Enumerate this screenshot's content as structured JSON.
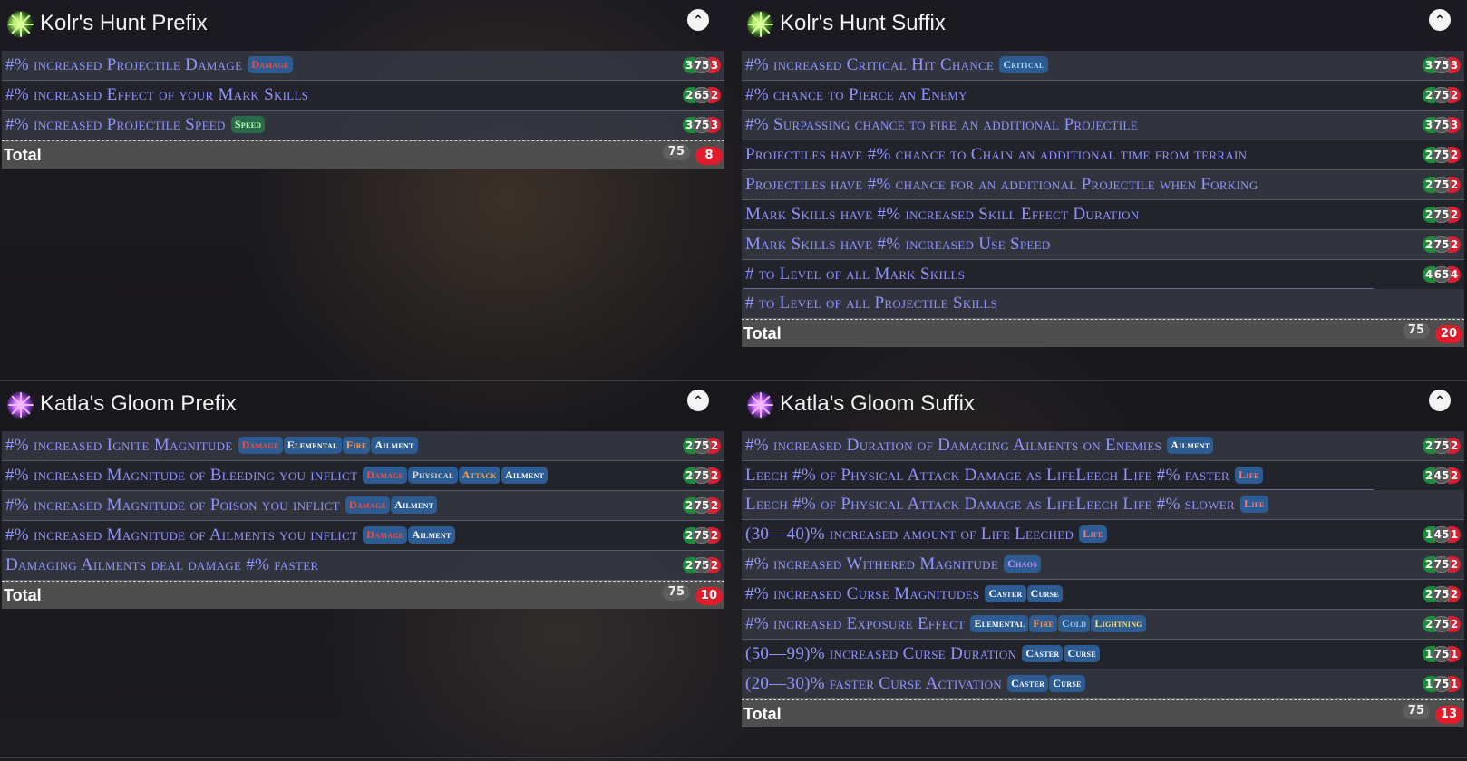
{
  "panels": [
    {
      "title": "Kolr's Hunt Prefix",
      "icon": "kolrs-hunt-icon",
      "rows": [
        {
          "text": "#% increased Projectile Damage",
          "tags": [
            {
              "label": "Damage",
              "kind": "damage"
            }
          ],
          "badges": [
            "3",
            "75",
            "3"
          ]
        },
        {
          "text": "#% increased Effect of your Mark Skills",
          "tags": [],
          "badges": [
            "2",
            "65",
            "2"
          ]
        },
        {
          "text": "#% increased Projectile Speed",
          "tags": [
            {
              "label": "Speed",
              "kind": "speed"
            }
          ],
          "badges": [
            "3",
            "75",
            "3"
          ]
        }
      ],
      "total": {
        "label": "Total",
        "ilvl": "75",
        "count": "8"
      }
    },
    {
      "title": "Kolr's Hunt Suffix",
      "icon": "kolrs-hunt-icon",
      "rows": [
        {
          "text": "#% increased Critical Hit Chance",
          "tags": [
            {
              "label": "Critical",
              "kind": "crit"
            }
          ],
          "badges": [
            "3",
            "75",
            "3"
          ]
        },
        {
          "text": "#% chance to Pierce an Enemy",
          "tags": [],
          "badges": [
            "2",
            "75",
            "2"
          ]
        },
        {
          "text": "#% Surpassing chance to fire an additional Projectile",
          "tags": [],
          "badges": [
            "3",
            "75",
            "3"
          ]
        },
        {
          "text": "Projectiles have #% chance to Chain an additional time from terrain",
          "tags": [],
          "badges": [
            "2",
            "75",
            "2"
          ]
        },
        {
          "text": "Projectiles have #% chance for an additional Projectile when Forking",
          "tags": [],
          "badges": [
            "2",
            "75",
            "2"
          ]
        },
        {
          "text": "Mark Skills have #% increased Skill Effect Duration",
          "tags": [],
          "badges": [
            "2",
            "75",
            "2"
          ]
        },
        {
          "text": "Mark Skills have #% increased Use Speed",
          "tags": [],
          "badges": [
            "2",
            "75",
            "2"
          ]
        },
        {
          "text": "# to Level of all Mark Skills",
          "tags": [],
          "badges": [
            "4",
            "65",
            "4"
          ],
          "merged": "top"
        },
        {
          "text": "# to Level of all Projectile Skills",
          "tags": [],
          "badges": null,
          "merged": "bottom"
        }
      ],
      "total": {
        "label": "Total",
        "ilvl": "75",
        "count": "20"
      }
    },
    {
      "title": "Katla's Gloom Prefix",
      "icon": "katlas-gloom-icon",
      "rows": [
        {
          "text": "#% increased Ignite Magnitude",
          "tags": [
            {
              "label": "Damage",
              "kind": "damage"
            },
            {
              "label": "Elemental",
              "kind": "elemental"
            },
            {
              "label": "Fire",
              "kind": "fire"
            },
            {
              "label": "Ailment",
              "kind": "ailment"
            }
          ],
          "badges": [
            "2",
            "75",
            "2"
          ]
        },
        {
          "text": "#% increased Magnitude of Bleeding you inflict",
          "tags": [
            {
              "label": "Damage",
              "kind": "damage"
            },
            {
              "label": "Physical",
              "kind": "physical"
            },
            {
              "label": "Attack",
              "kind": "attack"
            },
            {
              "label": "Ailment",
              "kind": "ailment"
            }
          ],
          "badges": [
            "2",
            "75",
            "2"
          ]
        },
        {
          "text": "#% increased Magnitude of Poison you inflict",
          "tags": [
            {
              "label": "Damage",
              "kind": "damage"
            },
            {
              "label": "Ailment",
              "kind": "ailment"
            }
          ],
          "badges": [
            "2",
            "75",
            "2"
          ]
        },
        {
          "text": "#% increased Magnitude of Ailments you inflict",
          "tags": [
            {
              "label": "Damage",
              "kind": "damage"
            },
            {
              "label": "Ailment",
              "kind": "ailment"
            }
          ],
          "badges": [
            "2",
            "75",
            "2"
          ]
        },
        {
          "text": "Damaging Ailments deal damage #% faster",
          "tags": [],
          "badges": [
            "2",
            "75",
            "2"
          ]
        }
      ],
      "total": {
        "label": "Total",
        "ilvl": "75",
        "count": "10"
      }
    },
    {
      "title": "Katla's Gloom Suffix",
      "icon": "katlas-gloom-icon",
      "rows": [
        {
          "text": "#% increased Duration of Damaging Ailments on Enemies",
          "tags": [
            {
              "label": "Ailment",
              "kind": "ailment"
            }
          ],
          "badges": [
            "2",
            "75",
            "2"
          ]
        },
        {
          "text": "Leech #% of Physical Attack Damage as LifeLeech Life #% faster",
          "tags": [
            {
              "label": "Life",
              "kind": "life"
            }
          ],
          "badges": [
            "2",
            "45",
            "2"
          ],
          "merged": "top"
        },
        {
          "text": "Leech #% of Physical Attack Damage as LifeLeech Life #% slower",
          "tags": [
            {
              "label": "Life",
              "kind": "life"
            }
          ],
          "badges": null,
          "merged": "bottom"
        },
        {
          "text": "(30—40)% increased amount of Life Leeched",
          "tags": [
            {
              "label": "Life",
              "kind": "life"
            }
          ],
          "badges": [
            "1",
            "45",
            "1"
          ]
        },
        {
          "text": "#% increased Withered Magnitude",
          "tags": [
            {
              "label": "Chaos",
              "kind": "chaos"
            }
          ],
          "badges": [
            "2",
            "75",
            "2"
          ]
        },
        {
          "text": "#% increased Curse Magnitudes",
          "tags": [
            {
              "label": "Caster",
              "kind": "caster"
            },
            {
              "label": "Curse",
              "kind": "curse"
            }
          ],
          "badges": [
            "2",
            "75",
            "2"
          ]
        },
        {
          "text": "#% increased Exposure Effect",
          "tags": [
            {
              "label": "Elemental",
              "kind": "elemental"
            },
            {
              "label": "Fire",
              "kind": "fire"
            },
            {
              "label": "Cold",
              "kind": "cold"
            },
            {
              "label": "Lightning",
              "kind": "lightning"
            }
          ],
          "badges": [
            "2",
            "75",
            "2"
          ]
        },
        {
          "text": "(50—99)% increased Curse Duration",
          "tags": [
            {
              "label": "Caster",
              "kind": "caster"
            },
            {
              "label": "Curse",
              "kind": "curse"
            }
          ],
          "badges": [
            "1",
            "75",
            "1"
          ]
        },
        {
          "text": "(20—30)% faster Curse Activation",
          "tags": [
            {
              "label": "Caster",
              "kind": "caster"
            },
            {
              "label": "Curse",
              "kind": "curse"
            }
          ],
          "badges": [
            "1",
            "75",
            "1"
          ]
        }
      ],
      "total": {
        "label": "Total",
        "ilvl": "75",
        "count": "13"
      }
    }
  ],
  "colors": {
    "mod_text": "#8f95ff",
    "tier_green": "#1e8a3a",
    "tier_red": "#d81f2f",
    "tier_gray": "#555555",
    "tag_bg": "#2d5c92",
    "total_bg": "#4e4e4e"
  }
}
